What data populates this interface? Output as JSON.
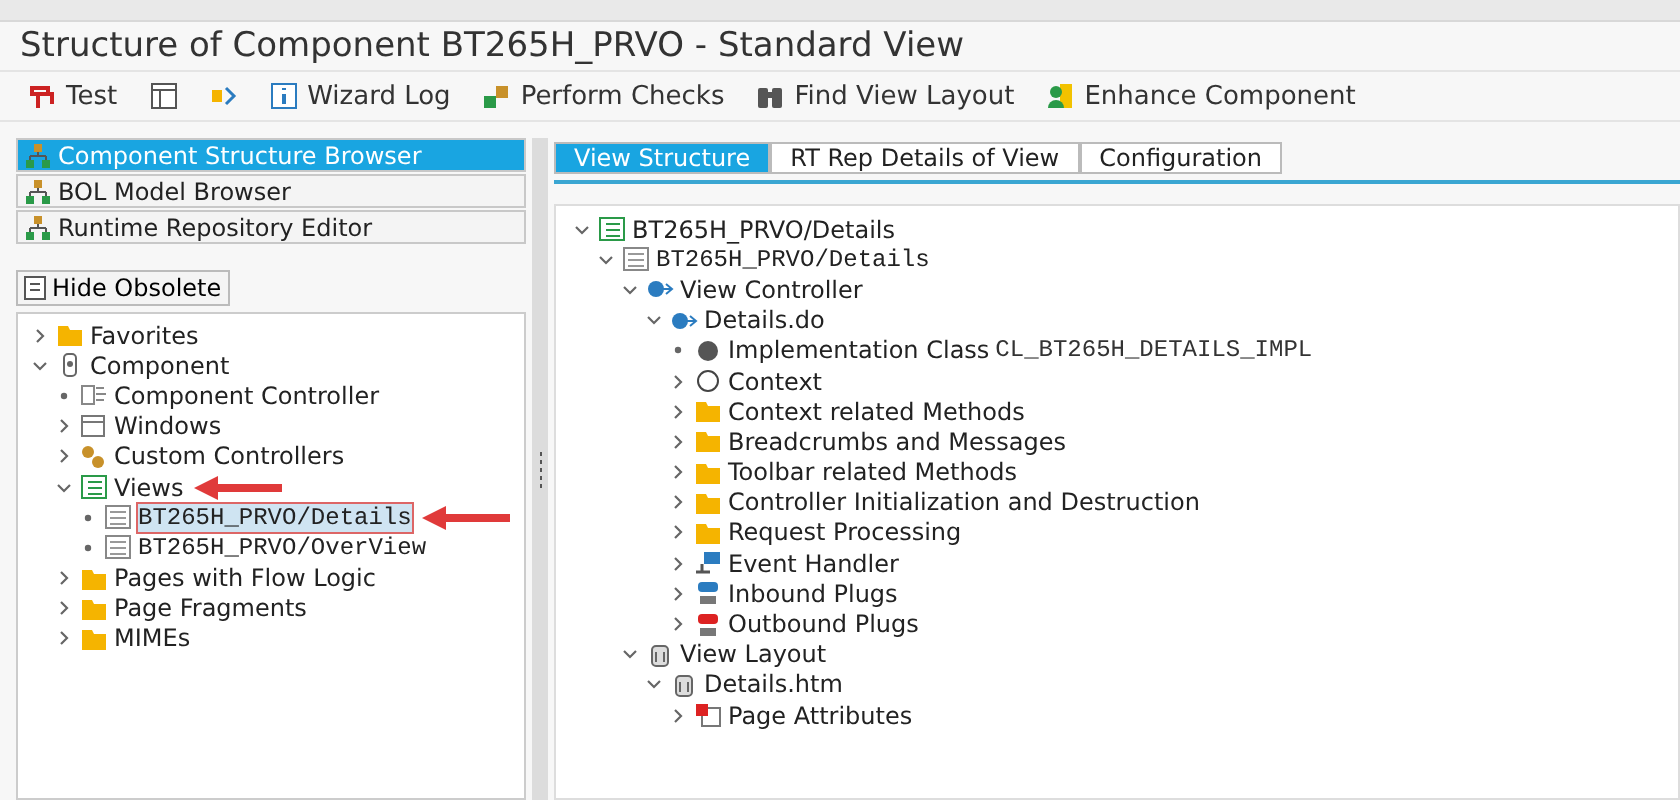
{
  "window": {
    "title": "Structure of Component BT265H_PRVO - Standard View"
  },
  "toolbar": [
    {
      "label": "Test",
      "kind": "test"
    },
    {
      "kind": "layout"
    },
    {
      "kind": "flow"
    },
    {
      "label": "Wizard Log",
      "kind": "info"
    },
    {
      "label": "Perform Checks",
      "kind": "checks"
    },
    {
      "label": "Find View Layout",
      "kind": "binoculars"
    },
    {
      "label": "Enhance Component",
      "kind": "person"
    }
  ],
  "navigation": [
    {
      "label": "Component Structure Browser",
      "selected": true
    },
    {
      "label": "BOL Model Browser",
      "selected": false
    },
    {
      "label": "Runtime Repository Editor",
      "selected": false
    }
  ],
  "hide_obsolete_button": "Hide Obsolete",
  "component_tree": [
    {
      "label": "Favorites",
      "kind": "folder",
      "expanded": false
    },
    {
      "label": "Component",
      "kind": "component",
      "expanded": true,
      "children": [
        {
          "label": "Component Controller",
          "kind": "controller"
        },
        {
          "label": "Windows",
          "kind": "window",
          "expanded": false
        },
        {
          "label": "Custom Controllers",
          "kind": "custom",
          "expanded": false
        },
        {
          "label": "Views",
          "kind": "views",
          "expanded": true,
          "arrow": true,
          "children": [
            {
              "label": "BT265H_PRVO/Details",
              "kind": "view",
              "selected": true,
              "arrow": true
            },
            {
              "label": "BT265H_PRVO/OverView",
              "kind": "view",
              "selected": false
            }
          ]
        },
        {
          "label": "Pages with Flow Logic",
          "kind": "folder",
          "expanded": false
        },
        {
          "label": "Page Fragments",
          "kind": "folder",
          "expanded": false
        },
        {
          "label": "MIMEs",
          "kind": "folder",
          "expanded": false
        }
      ]
    }
  ],
  "tabs": [
    {
      "label": "View Structure",
      "selected": true
    },
    {
      "label": "RT Rep Details of View",
      "selected": false
    },
    {
      "label": "Configuration",
      "selected": false
    }
  ],
  "view_tree": [
    {
      "label": "BT265H_PRVO/Details",
      "kind": "views",
      "expanded": true,
      "children": [
        {
          "label": "BT265H_PRVO/Details",
          "kind": "view",
          "expanded": true,
          "children": [
            {
              "label": "View Controller",
              "kind": "vc",
              "expanded": true,
              "children": [
                {
                  "label": "Details.do",
                  "kind": "vc",
                  "expanded": true,
                  "children": [
                    {
                      "label": "Implementation Class",
                      "value": "CL_BT265H_DETAILS_IMPL",
                      "kind": "ball"
                    },
                    {
                      "label": "Context",
                      "kind": "circle",
                      "expanded": false
                    },
                    {
                      "label": "Context related Methods",
                      "kind": "folder",
                      "expanded": false
                    },
                    {
                      "label": "Breadcrumbs and Messages",
                      "kind": "folder",
                      "expanded": false
                    },
                    {
                      "label": "Toolbar related Methods",
                      "kind": "folder",
                      "expanded": false
                    },
                    {
                      "label": "Controller Initialization and Destruction",
                      "kind": "folder",
                      "expanded": false
                    },
                    {
                      "label": "Request Processing",
                      "kind": "folder",
                      "expanded": false
                    },
                    {
                      "label": "Event Handler",
                      "kind": "event",
                      "expanded": false
                    },
                    {
                      "label": "Inbound Plugs",
                      "kind": "inplug",
                      "expanded": false
                    },
                    {
                      "label": "Outbound Plugs",
                      "kind": "outplug",
                      "expanded": false
                    }
                  ]
                }
              ]
            },
            {
              "label": "View Layout",
              "kind": "jar",
              "expanded": true,
              "children": [
                {
                  "label": "Details.htm",
                  "kind": "jar",
                  "expanded": true,
                  "children": [
                    {
                      "label": "Page Attributes",
                      "kind": "attrs",
                      "expanded": false
                    }
                  ]
                }
              ]
            }
          ]
        }
      ]
    }
  ]
}
